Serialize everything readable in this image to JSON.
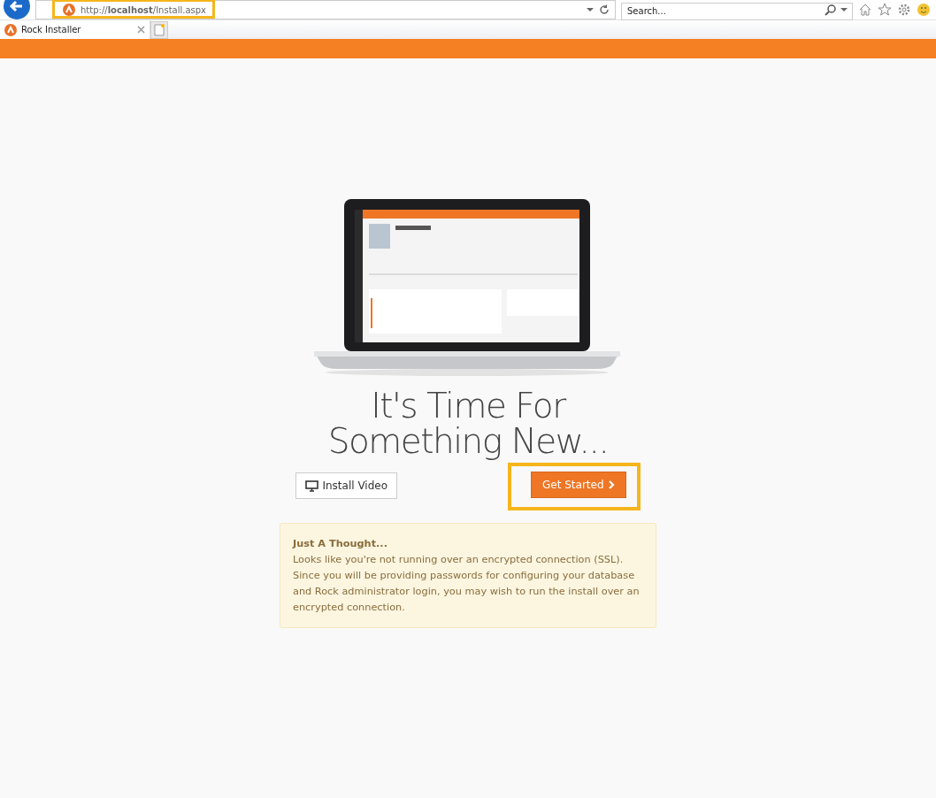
{
  "browser": {
    "address": "http://**localhost**/Install.aspx",
    "search": {
      "placeholder": "Search..."
    },
    "tabs": [
      {
        "title": "Rock Installer",
        "selected": true
      }
    ]
  },
  "page": {
    "heading": [
      "It's Time For",
      "Something New..."
    ],
    "buttons": [
      {
        "kind": "video",
        "label": "Install Video"
      },
      {
        "kind": "primary",
        "label": "Get Started"
      }
    ],
    "alert": {
      "title": "Just A Thought...",
      "text": "Looks like you're not running over an encrypted connection (SSL). Since you will be providing passwords for configuring your database and Rock administrator login, you may wish to run the install over an encrypted connection."
    }
  }
}
